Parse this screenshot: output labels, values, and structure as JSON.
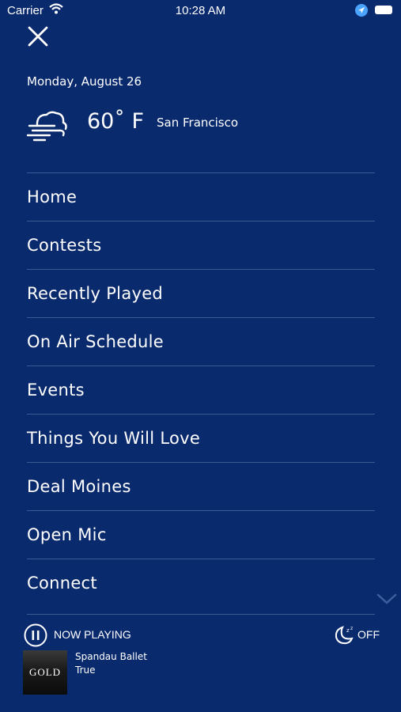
{
  "status_bar": {
    "carrier": "Carrier",
    "time": "10:28 AM",
    "icons": [
      "wifi-icon",
      "location-arrow-icon",
      "battery-icon"
    ]
  },
  "header": {
    "close_icon": "close-icon",
    "date": "Monday, August 26",
    "weather": {
      "icon": "cloud-wind-icon",
      "temperature": "60˚ F",
      "city": "San Francisco"
    }
  },
  "menu": {
    "items": [
      {
        "label": "Home"
      },
      {
        "label": "Contests"
      },
      {
        "label": "Recently Played"
      },
      {
        "label": "On Air Schedule"
      },
      {
        "label": "Events"
      },
      {
        "label": "Things You Will Love"
      },
      {
        "label": "Deal Moines"
      },
      {
        "label": "Open Mic"
      },
      {
        "label": "Connect"
      }
    ],
    "scroll_icon": "chevron-down-icon"
  },
  "player": {
    "now_playing_label": "NOW PLAYING",
    "pause_icon": "pause-icon",
    "sleep_icon": "sleep-timer-icon",
    "sleep_label": "OFF",
    "album_art_text": "GOLD",
    "artist": "Spandau Ballet",
    "title": "True"
  },
  "colors": {
    "background": "#0a2a6e",
    "divider": "#3d5a94",
    "text": "#ffffff",
    "scroll_chevron": "#3f5f9c"
  }
}
